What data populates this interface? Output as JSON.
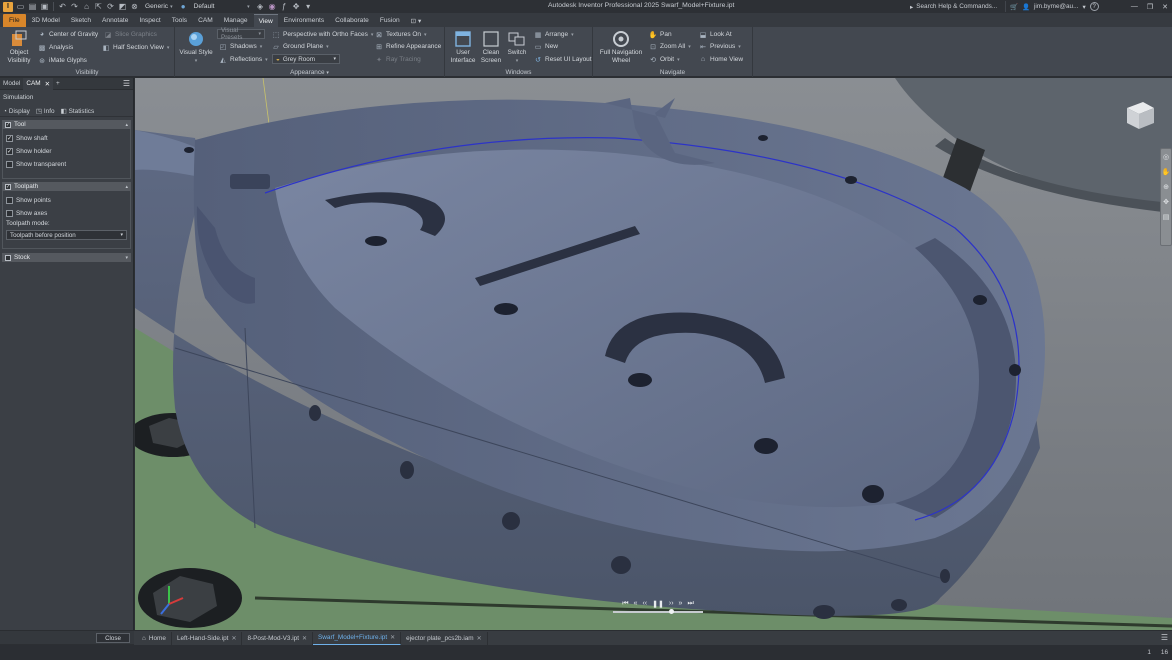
{
  "titlebar": {
    "app_title": "Autodesk Inventor Professional 2025   Swarf_Model+Fixture.ipt",
    "material_value": "Generic",
    "appearance_value": "Default",
    "search_placeholder": "Search Help & Commands...",
    "user": "jim.byme@au...",
    "help_label": "?"
  },
  "ribbon_tabs": [
    "File",
    "3D Model",
    "Sketch",
    "Annotate",
    "Inspect",
    "Tools",
    "CAM",
    "Manage",
    "View",
    "Environments",
    "Collaborate",
    "Fusion"
  ],
  "active_tab": "View",
  "ribbon": {
    "visibility": {
      "object_visibility": "Object\nVisibility",
      "center_of_gravity": "Center of Gravity",
      "analysis": "Analysis",
      "imate_glyphs": "iMate Glyphs",
      "slice_graphics": "Slice Graphics",
      "half_section_view": "Half Section View",
      "label": "Visibility"
    },
    "appearance": {
      "visual_style": "Visual Style",
      "visual_presets": "Visual Presets",
      "shadows": "Shadows",
      "reflections": "Reflections",
      "perspective": "Perspective with Ortho Faces",
      "ground_plane": "Ground Plane",
      "grey_room": "Grey Room",
      "textures_on": "Textures On",
      "refine_appearance": "Refine Appearance",
      "ray_tracing": "Ray Tracing",
      "label": "Appearance"
    },
    "windows": {
      "user_interface": "User\nInterface",
      "clean_screen": "Clean\nScreen",
      "switch": "Switch",
      "arrange": "Arrange",
      "new": "New",
      "reset_ui": "Reset UI Layout",
      "label": "Windows"
    },
    "navigate": {
      "full_nav_wheel": "Full Navigation\nWheel",
      "pan": "Pan",
      "zoom_all": "Zoom All",
      "orbit": "Orbit",
      "look_at": "Look At",
      "previous": "Previous",
      "home_view": "Home View",
      "label": "Navigate"
    }
  },
  "browser": {
    "tabs": [
      "Model",
      "CAM"
    ],
    "active_tab": "CAM",
    "add_tab": "+",
    "simulation_title": "Simulation",
    "subtabs": [
      "Display",
      "Info",
      "Statistics"
    ],
    "tool_section": {
      "title": "Tool",
      "checked": true,
      "options": [
        {
          "label": "Show shaft",
          "checked": true
        },
        {
          "label": "Show holder",
          "checked": true
        },
        {
          "label": "Show transparent",
          "checked": false
        }
      ]
    },
    "toolpath_section": {
      "title": "Toolpath",
      "checked": true,
      "options": [
        {
          "label": "Show points",
          "checked": false
        },
        {
          "label": "Show axes",
          "checked": false
        }
      ],
      "mode_label": "Toolpath mode:",
      "mode_value": "Toolpath before position"
    },
    "stock_section": {
      "title": "Stock",
      "checked": false
    },
    "close_label": "Close"
  },
  "document_tabs": [
    {
      "label": "Home",
      "active": false,
      "closable": false
    },
    {
      "label": "Left-Hand-Side.ipt",
      "active": false,
      "closable": true
    },
    {
      "label": "8-Post-Mod-V3.ipt",
      "active": false,
      "closable": true
    },
    {
      "label": "Swarf_Model+Fixture.ipt",
      "active": true,
      "closable": true
    },
    {
      "label": "ejector plate_pcs2b.iam",
      "active": false,
      "closable": true
    }
  ],
  "status": {
    "left_num": "1",
    "right_num": "16"
  },
  "simulation_playback": {
    "progress": 0.65
  },
  "colors": {
    "part_body": "#6a7690",
    "fixture_green": "#6d8e69",
    "toolpath_line": "#2c33c8",
    "file_tab": "#d8862a",
    "active_doc_tab": "#6fb1ea"
  }
}
